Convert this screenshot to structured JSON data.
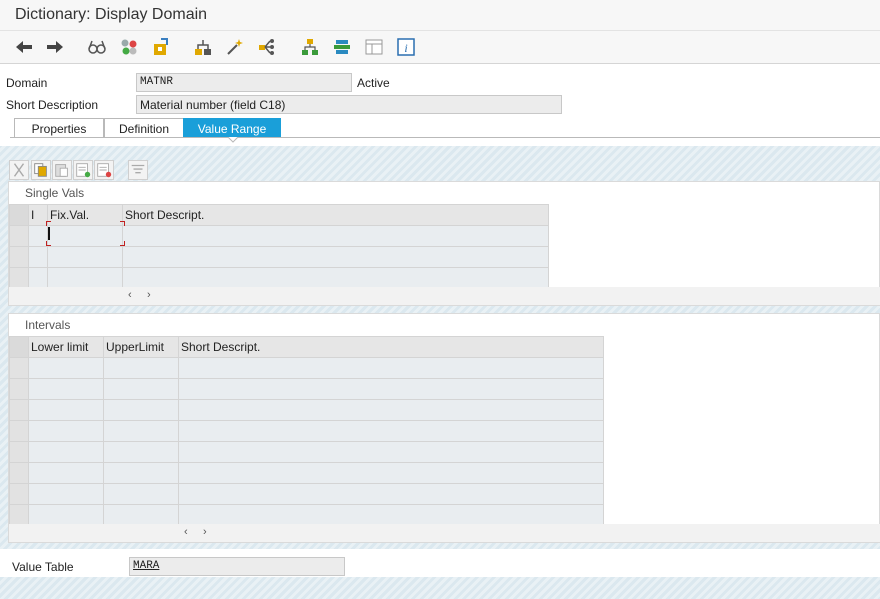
{
  "window": {
    "title": "Dictionary: Display Domain"
  },
  "toolbar": {
    "icons": [
      "back-arrow-icon",
      "forward-arrow-icon",
      "glasses-display-icon",
      "object-check-icon",
      "activate-icon",
      "where-used-icon",
      "magic-wand-icon",
      "distribute-icon",
      "hierarchy-icon",
      "stack-icon",
      "table-layout-icon",
      "info-icon"
    ]
  },
  "header": {
    "domain_label": "Domain",
    "domain_value": "MATNR",
    "status": "Active",
    "short_desc_label": "Short Description",
    "short_desc_value": "Material number (field C18)"
  },
  "tabs": [
    {
      "label": "Properties",
      "active": false
    },
    {
      "label": "Definition",
      "active": false
    },
    {
      "label": "Value Range",
      "active": true
    }
  ],
  "single_vals": {
    "title": "Single Vals",
    "columns": [
      "I",
      "Fix.Val.",
      "Short Descript."
    ],
    "rows": 3,
    "scroll_left": "‹",
    "scroll_right": "›"
  },
  "intervals": {
    "title": "Intervals",
    "columns": [
      "Lower limit",
      "UpperLimit",
      "Short Descript."
    ],
    "rows": 8,
    "scroll_left": "‹",
    "scroll_right": "›"
  },
  "value_table": {
    "label": "Value Table",
    "value": "MARA"
  },
  "colors": {
    "accent": "#1a9fd9",
    "cursor_frame": "#c02020"
  }
}
